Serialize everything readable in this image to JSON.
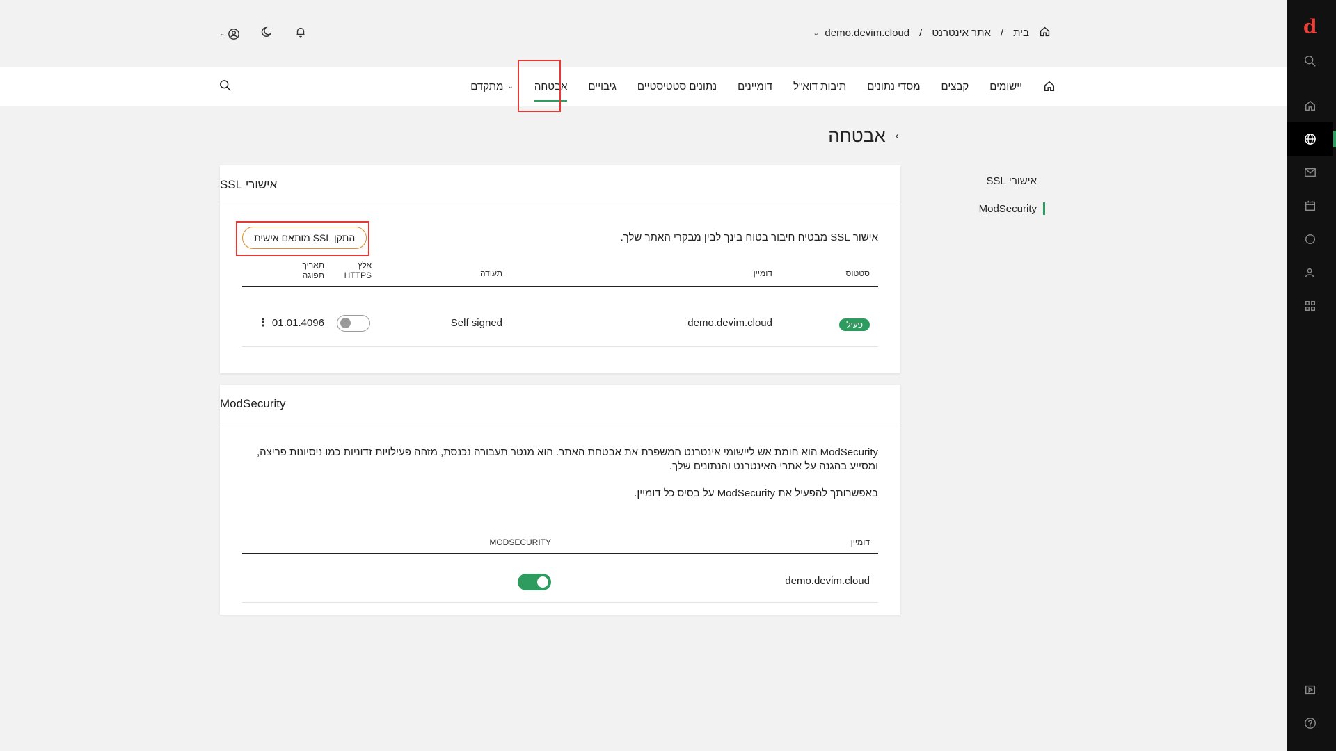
{
  "header": {
    "breadcrumbs": [
      "בית",
      "/",
      "אתר אינטרנט",
      "/",
      "demo.devim.cloud"
    ]
  },
  "nav": {
    "items": [
      "יישומים",
      "קבצים",
      "מסדי נתונים",
      "תיבות דוא\"ל",
      "דומיינים",
      "נתונים סטטיסטיים",
      "גיבויים",
      "אבטחה",
      "מתקדם"
    ],
    "active": "אבטחה"
  },
  "page": {
    "title": "אבטחה"
  },
  "side_menu": {
    "items": [
      "אישורי SSL",
      "ModSecurity"
    ],
    "active": "ModSecurity"
  },
  "ssl": {
    "title": "אישורי SSL",
    "description": "אישור SSL מבטיח חיבור בטוח בינך לבין מבקרי האתר שלך.",
    "install_button": "התקן SSL מותאם אישית",
    "columns": {
      "status": "סטטוס",
      "domain": "דומיין",
      "certificate": "תעודה",
      "force_https_1": "אלץ",
      "force_https_2": "HTTPS",
      "expiry_1": "תאריך",
      "expiry_2": "תפוגה"
    },
    "rows": [
      {
        "status": "פעיל",
        "domain": "demo.devim.cloud",
        "certificate": "Self signed",
        "force_https": false,
        "expiry": "01.01.4096"
      }
    ]
  },
  "modsecurity": {
    "title": "ModSecurity",
    "paragraph1": "ModSecurity הוא חומת אש ליישומי אינטרנט המשפרת את אבטחת האתר. הוא מנטר תעבורה נכנסת, מזהה פעילויות זדוניות כמו ניסיונות פריצה, ומסייע בהגנה על אתרי האינטרנט והנתונים שלך.",
    "paragraph2": "באפשרותך להפעיל את ModSecurity על בסיס כל דומיין.",
    "columns": {
      "domain": "דומיין",
      "modsecurity": "MODSECURITY"
    },
    "rows": [
      {
        "domain": "demo.devim.cloud",
        "enabled": true
      }
    ]
  },
  "rail": {
    "logo": "d"
  },
  "colors": {
    "accent": "#2e9b5f",
    "highlight": "#e53935",
    "button_border": "#e08a2c",
    "logo": "#e8413c"
  }
}
